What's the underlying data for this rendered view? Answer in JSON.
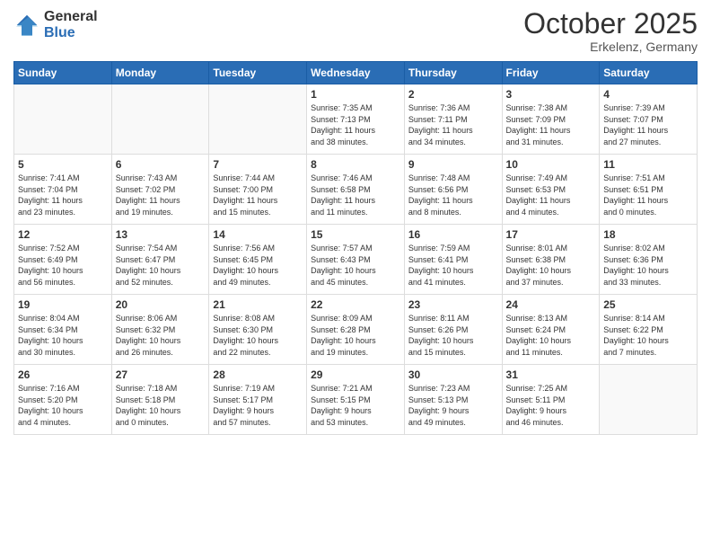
{
  "logo": {
    "general": "General",
    "blue": "Blue"
  },
  "title": "October 2025",
  "location": "Erkelenz, Germany",
  "days_of_week": [
    "Sunday",
    "Monday",
    "Tuesday",
    "Wednesday",
    "Thursday",
    "Friday",
    "Saturday"
  ],
  "weeks": [
    [
      {
        "day": "",
        "info": ""
      },
      {
        "day": "",
        "info": ""
      },
      {
        "day": "",
        "info": ""
      },
      {
        "day": "1",
        "info": "Sunrise: 7:35 AM\nSunset: 7:13 PM\nDaylight: 11 hours\nand 38 minutes."
      },
      {
        "day": "2",
        "info": "Sunrise: 7:36 AM\nSunset: 7:11 PM\nDaylight: 11 hours\nand 34 minutes."
      },
      {
        "day": "3",
        "info": "Sunrise: 7:38 AM\nSunset: 7:09 PM\nDaylight: 11 hours\nand 31 minutes."
      },
      {
        "day": "4",
        "info": "Sunrise: 7:39 AM\nSunset: 7:07 PM\nDaylight: 11 hours\nand 27 minutes."
      }
    ],
    [
      {
        "day": "5",
        "info": "Sunrise: 7:41 AM\nSunset: 7:04 PM\nDaylight: 11 hours\nand 23 minutes."
      },
      {
        "day": "6",
        "info": "Sunrise: 7:43 AM\nSunset: 7:02 PM\nDaylight: 11 hours\nand 19 minutes."
      },
      {
        "day": "7",
        "info": "Sunrise: 7:44 AM\nSunset: 7:00 PM\nDaylight: 11 hours\nand 15 minutes."
      },
      {
        "day": "8",
        "info": "Sunrise: 7:46 AM\nSunset: 6:58 PM\nDaylight: 11 hours\nand 11 minutes."
      },
      {
        "day": "9",
        "info": "Sunrise: 7:48 AM\nSunset: 6:56 PM\nDaylight: 11 hours\nand 8 minutes."
      },
      {
        "day": "10",
        "info": "Sunrise: 7:49 AM\nSunset: 6:53 PM\nDaylight: 11 hours\nand 4 minutes."
      },
      {
        "day": "11",
        "info": "Sunrise: 7:51 AM\nSunset: 6:51 PM\nDaylight: 11 hours\nand 0 minutes."
      }
    ],
    [
      {
        "day": "12",
        "info": "Sunrise: 7:52 AM\nSunset: 6:49 PM\nDaylight: 10 hours\nand 56 minutes."
      },
      {
        "day": "13",
        "info": "Sunrise: 7:54 AM\nSunset: 6:47 PM\nDaylight: 10 hours\nand 52 minutes."
      },
      {
        "day": "14",
        "info": "Sunrise: 7:56 AM\nSunset: 6:45 PM\nDaylight: 10 hours\nand 49 minutes."
      },
      {
        "day": "15",
        "info": "Sunrise: 7:57 AM\nSunset: 6:43 PM\nDaylight: 10 hours\nand 45 minutes."
      },
      {
        "day": "16",
        "info": "Sunrise: 7:59 AM\nSunset: 6:41 PM\nDaylight: 10 hours\nand 41 minutes."
      },
      {
        "day": "17",
        "info": "Sunrise: 8:01 AM\nSunset: 6:38 PM\nDaylight: 10 hours\nand 37 minutes."
      },
      {
        "day": "18",
        "info": "Sunrise: 8:02 AM\nSunset: 6:36 PM\nDaylight: 10 hours\nand 33 minutes."
      }
    ],
    [
      {
        "day": "19",
        "info": "Sunrise: 8:04 AM\nSunset: 6:34 PM\nDaylight: 10 hours\nand 30 minutes."
      },
      {
        "day": "20",
        "info": "Sunrise: 8:06 AM\nSunset: 6:32 PM\nDaylight: 10 hours\nand 26 minutes."
      },
      {
        "day": "21",
        "info": "Sunrise: 8:08 AM\nSunset: 6:30 PM\nDaylight: 10 hours\nand 22 minutes."
      },
      {
        "day": "22",
        "info": "Sunrise: 8:09 AM\nSunset: 6:28 PM\nDaylight: 10 hours\nand 19 minutes."
      },
      {
        "day": "23",
        "info": "Sunrise: 8:11 AM\nSunset: 6:26 PM\nDaylight: 10 hours\nand 15 minutes."
      },
      {
        "day": "24",
        "info": "Sunrise: 8:13 AM\nSunset: 6:24 PM\nDaylight: 10 hours\nand 11 minutes."
      },
      {
        "day": "25",
        "info": "Sunrise: 8:14 AM\nSunset: 6:22 PM\nDaylight: 10 hours\nand 7 minutes."
      }
    ],
    [
      {
        "day": "26",
        "info": "Sunrise: 7:16 AM\nSunset: 5:20 PM\nDaylight: 10 hours\nand 4 minutes."
      },
      {
        "day": "27",
        "info": "Sunrise: 7:18 AM\nSunset: 5:18 PM\nDaylight: 10 hours\nand 0 minutes."
      },
      {
        "day": "28",
        "info": "Sunrise: 7:19 AM\nSunset: 5:17 PM\nDaylight: 9 hours\nand 57 minutes."
      },
      {
        "day": "29",
        "info": "Sunrise: 7:21 AM\nSunset: 5:15 PM\nDaylight: 9 hours\nand 53 minutes."
      },
      {
        "day": "30",
        "info": "Sunrise: 7:23 AM\nSunset: 5:13 PM\nDaylight: 9 hours\nand 49 minutes."
      },
      {
        "day": "31",
        "info": "Sunrise: 7:25 AM\nSunset: 5:11 PM\nDaylight: 9 hours\nand 46 minutes."
      },
      {
        "day": "",
        "info": ""
      }
    ]
  ]
}
